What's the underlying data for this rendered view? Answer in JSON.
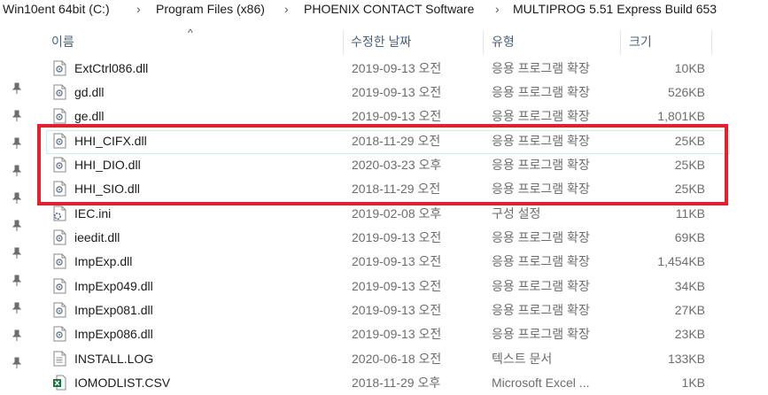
{
  "breadcrumb": {
    "items": [
      "Win10ent 64bit (C:)",
      "Program Files (x86)",
      "PHOENIX CONTACT Software",
      "MULTIPROG 5.51 Express Build 653"
    ],
    "separator": "›"
  },
  "columns": {
    "name": "이름",
    "date": "수정한 날짜",
    "type": "유형",
    "size": "크기"
  },
  "colors": {
    "highlight_border": "#e4202a",
    "header_text": "#4c607a"
  },
  "files": [
    {
      "name": "ExtCtrl086.dll",
      "date": "2019-09-13 오전",
      "type": "응용 프로그램 확장",
      "size": "10KB",
      "icon": "dll-file-icon"
    },
    {
      "name": "gd.dll",
      "date": "2019-09-13 오전",
      "type": "응용 프로그램 확장",
      "size": "526KB",
      "icon": "dll-file-icon"
    },
    {
      "name": "ge.dll",
      "date": "2019-09-13 오전",
      "type": "응용 프로그램 확장",
      "size": "1,801KB",
      "icon": "dll-file-icon"
    },
    {
      "name": "HHI_CIFX.dll",
      "date": "2018-11-29 오전",
      "type": "응용 프로그램 확장",
      "size": "25KB",
      "icon": "dll-file-icon"
    },
    {
      "name": "HHI_DIO.dll",
      "date": "2020-03-23 오후",
      "type": "응용 프로그램 확장",
      "size": "25KB",
      "icon": "dll-file-icon"
    },
    {
      "name": "HHI_SIO.dll",
      "date": "2018-11-29 오전",
      "type": "응용 프로그램 확장",
      "size": "25KB",
      "icon": "dll-file-icon"
    },
    {
      "name": "IEC.ini",
      "date": "2019-02-08 오후",
      "type": "구성 설정",
      "size": "11KB",
      "icon": "ini-file-icon"
    },
    {
      "name": "ieedit.dll",
      "date": "2019-09-13 오전",
      "type": "응용 프로그램 확장",
      "size": "69KB",
      "icon": "dll-file-icon"
    },
    {
      "name": "ImpExp.dll",
      "date": "2019-09-13 오전",
      "type": "응용 프로그램 확장",
      "size": "1,454KB",
      "icon": "dll-file-icon"
    },
    {
      "name": "ImpExp049.dll",
      "date": "2019-09-13 오전",
      "type": "응용 프로그램 확장",
      "size": "34KB",
      "icon": "dll-file-icon"
    },
    {
      "name": "ImpExp081.dll",
      "date": "2019-09-13 오전",
      "type": "응용 프로그램 확장",
      "size": "27KB",
      "icon": "dll-file-icon"
    },
    {
      "name": "ImpExp086.dll",
      "date": "2019-09-13 오전",
      "type": "응용 프로그램 확장",
      "size": "23KB",
      "icon": "dll-file-icon"
    },
    {
      "name": "INSTALL.LOG",
      "date": "2020-06-18 오전",
      "type": "텍스트 문서",
      "size": "133KB",
      "icon": "text-file-icon"
    },
    {
      "name": "IOMODLIST.CSV",
      "date": "2018-11-29 오후",
      "type": "Microsoft Excel ...",
      "size": "1KB",
      "icon": "excel-file-icon"
    }
  ]
}
